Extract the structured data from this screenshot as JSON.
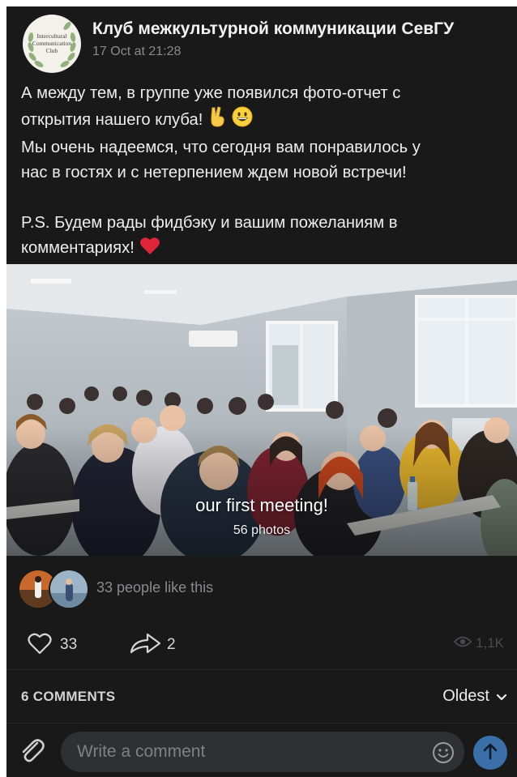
{
  "post": {
    "group_name": "Клуб межкультурной коммуникации СевГУ",
    "avatar_text": "Intercultural Communication Club",
    "date": "17 Oct at 21:28",
    "text_lines": {
      "l1": "А между тем, в группе уже появился фото-отчет с",
      "l2": "открытия нашего клуба!",
      "l3": "Мы очень надеемся, что сегодня вам понравилось у",
      "l4": "нас в гостях и с нетерпением ждем новой встречи!",
      "l5": "P.S. Будем рады фидбэку и вашим пожеланиям в",
      "l6": "комментариях!"
    },
    "emojis": [
      "victory-hand",
      "grinning-face",
      "red-heart"
    ]
  },
  "album": {
    "title": "our first meeting!",
    "count": "56 photos"
  },
  "likes": {
    "text": "33 people like this"
  },
  "actions": {
    "like_count": "33",
    "share_count": "2",
    "views": "1,1K"
  },
  "comments": {
    "count_label": "6 COMMENTS",
    "sort_label": "Oldest"
  },
  "composer": {
    "placeholder": "Write a comment"
  },
  "colors": {
    "background": "#19191a",
    "accent": "#3a6fa8",
    "muted_text": "#8a8a8c",
    "heart": "#e0243a"
  }
}
